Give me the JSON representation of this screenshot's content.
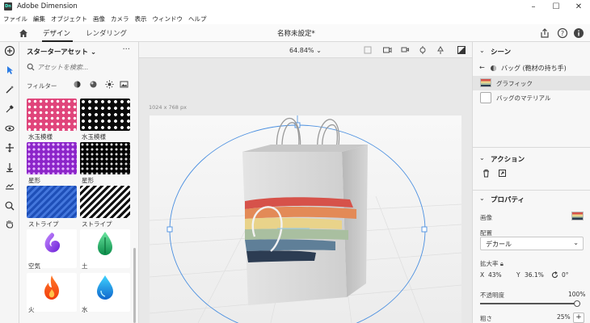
{
  "window": {
    "title": "Adobe Dimension",
    "app_badge": "Dn"
  },
  "menu": [
    "ファイル",
    "編集",
    "オブジェクト",
    "画像",
    "カメラ",
    "表示",
    "ウィンドウ",
    "ヘルプ"
  ],
  "tabs": {
    "design": "デザイン",
    "rendering": "レンダリング"
  },
  "document": {
    "title": "名称未設定*",
    "size": "1024 x 768 px"
  },
  "canvas": {
    "zoom": "64.84%"
  },
  "assets": {
    "heading": "スターターアセット",
    "search_placeholder": "アセットを検索...",
    "filter_label": "フィルター",
    "items": [
      {
        "label": "水玉模様"
      },
      {
        "label": "水玉模様"
      },
      {
        "label": "星形"
      },
      {
        "label": "星形"
      },
      {
        "label": "ストライプ"
      },
      {
        "label": "ストライプ"
      },
      {
        "label": "空気"
      },
      {
        "label": "土"
      },
      {
        "label": "火"
      },
      {
        "label": "水"
      }
    ]
  },
  "scene": {
    "heading": "シーン",
    "group_name": "バッグ (鞄材の持ち手)",
    "items": [
      "グラフィック",
      "バッグのマテリアル"
    ]
  },
  "actions": {
    "heading": "アクション"
  },
  "properties": {
    "heading": "プロパティ",
    "image_label": "画像",
    "placement_label": "配置",
    "placement_value": "デカール",
    "scale_label": "拡大率",
    "x_label": "X",
    "x_value": "43%",
    "y_label": "Y",
    "y_value": "36.1%",
    "rotation_value": "0°",
    "opacity_label": "不透明度",
    "opacity_value": "100%",
    "opacity_level": 1.0,
    "roughness_label": "粗さ",
    "roughness_value": "25%",
    "roughness_level": 0.25
  },
  "colors": {
    "accent": "#2b7be4",
    "selection": "#e4e4e4"
  }
}
